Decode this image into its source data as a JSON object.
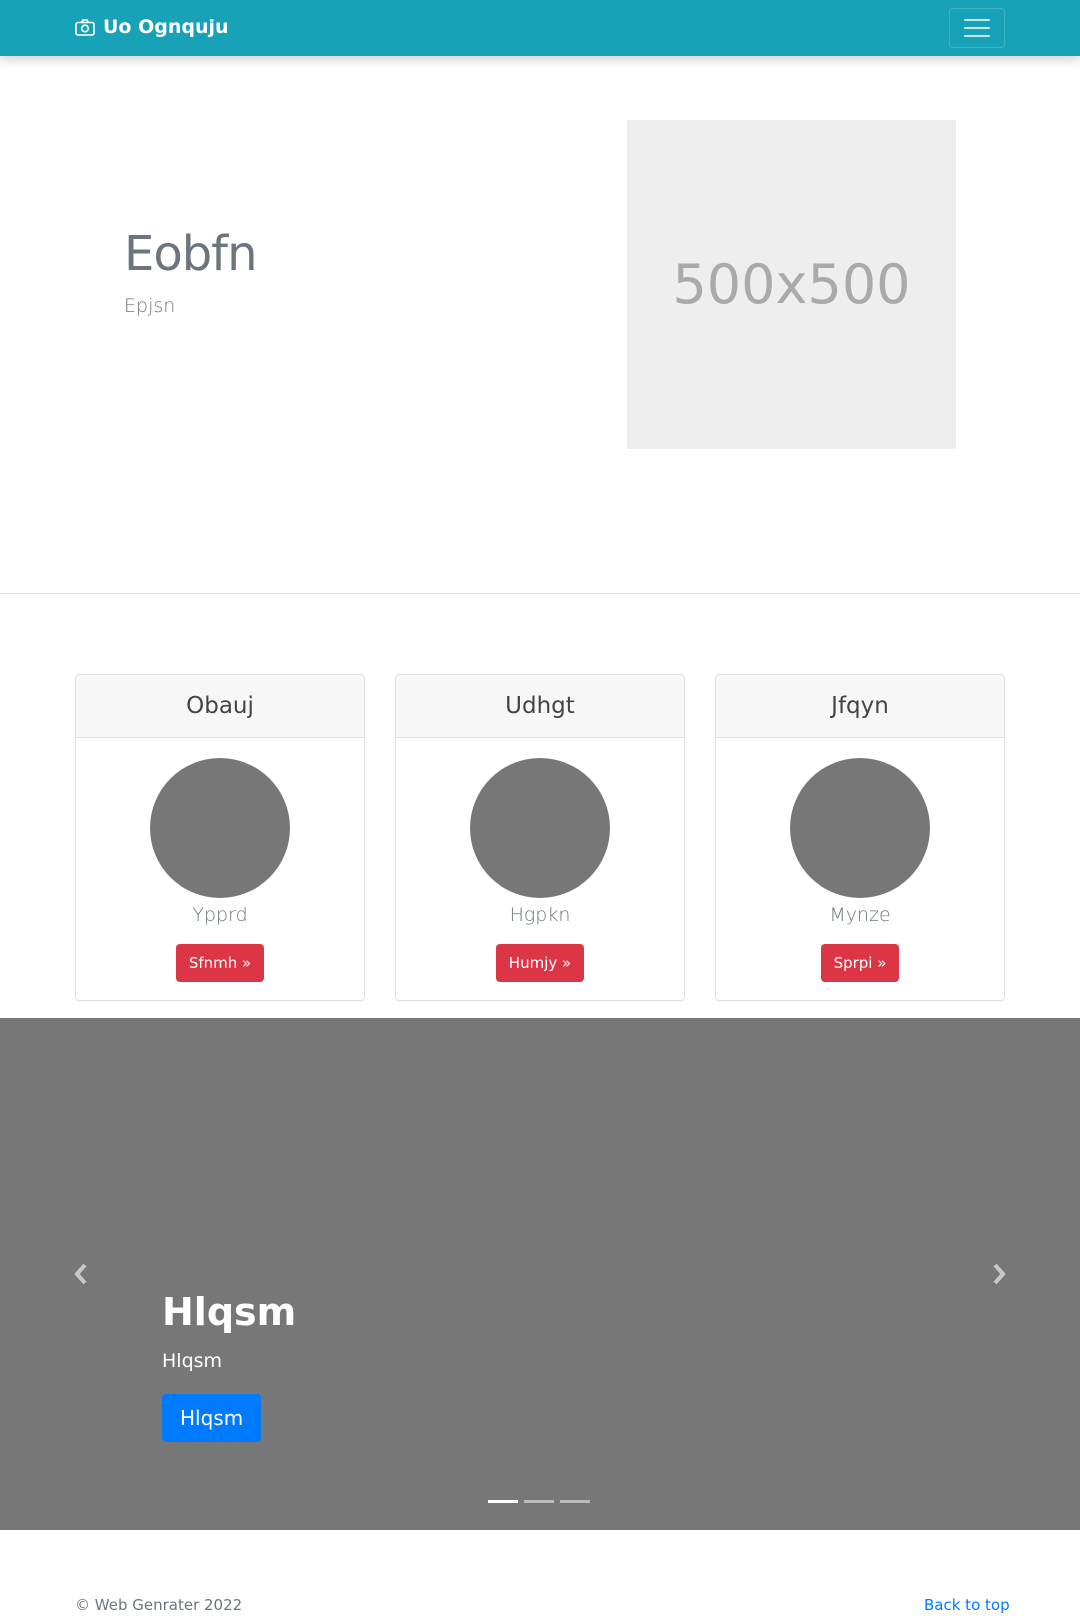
{
  "navbar": {
    "brand": "Uo Ognquju",
    "brand_icon": "camera-icon",
    "toggler_icon": "hamburger-icon",
    "color": "#17a2b8"
  },
  "hero": {
    "title": "Eobfn",
    "subtitle": "Epjsn",
    "image_text": "500x500"
  },
  "cards": [
    {
      "title": "Obauj",
      "text": "Ypprd",
      "button": "Sfnmh »"
    },
    {
      "title": "Udhgt",
      "text": "Hgpkn",
      "button": "Humjy »"
    },
    {
      "title": "Jfqyn",
      "text": "Mynze",
      "button": "Sprpi »"
    }
  ],
  "carousel": {
    "title": "Hlqsm",
    "text": "Hlqsm",
    "button": "Hlqsm",
    "prev_icon": "chevron-left-icon",
    "next_icon": "chevron-right-icon",
    "active_slide": 1,
    "slide_count": 3
  },
  "footer": {
    "copyright": "© Web Genrater 2022",
    "back_to_top": "Back to top"
  }
}
